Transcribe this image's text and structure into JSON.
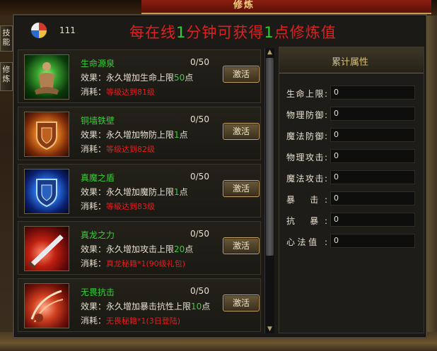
{
  "window": {
    "title": "修炼"
  },
  "side_tabs": [
    {
      "label": "技能"
    },
    {
      "label": "修炼"
    }
  ],
  "header": {
    "coin_icon": "yin-yang-coin-icon",
    "coin_count": "111",
    "banner_prefix": "每在线",
    "banner_num1": "1",
    "banner_mid": "分钟可获得",
    "banner_num2": "1",
    "banner_suffix": "点修炼值"
  },
  "skills": [
    {
      "icon": "meditating-figure-icon",
      "name": "生命源泉",
      "progress": "0/50",
      "effect_prefix": "效果：永久增加生命上限",
      "effect_value": "50",
      "effect_unit": "点",
      "cost_label": "消耗：",
      "cost_req": "等级达到81级",
      "button": "激活"
    },
    {
      "icon": "bronze-shield-icon",
      "name": "铜墙铁壁",
      "progress": "0/50",
      "effect_prefix": "效果：永久增加物防上限",
      "effect_value": "1",
      "effect_unit": "点",
      "cost_label": "消耗：",
      "cost_req": "等级达到82级",
      "button": "激活"
    },
    {
      "icon": "blue-shield-icon",
      "name": "真魔之盾",
      "progress": "0/50",
      "effect_prefix": "效果：永久增加魔防上限",
      "effect_value": "1",
      "effect_unit": "点",
      "cost_label": "消耗：",
      "cost_req": "等级达到83级",
      "button": "激活"
    },
    {
      "icon": "sword-slash-icon",
      "name": "真龙之力",
      "progress": "0/50",
      "effect_prefix": "效果：永久增加攻击上限",
      "effect_value": "20",
      "effect_unit": "点",
      "cost_label": "消耗：",
      "cost_req": "真龙秘籍*1(90级礼包)",
      "button": "激活"
    },
    {
      "icon": "fearless-strike-icon",
      "name": "无畏抗击",
      "progress": "0/50",
      "effect_prefix": "效果：永久增加暴击抗性上限",
      "effect_value": "10",
      "effect_unit": "点",
      "cost_label": "消耗：",
      "cost_req": "无畏秘籍*1(3日登陆)",
      "button": "激活"
    }
  ],
  "stats": {
    "title": "累计属性",
    "rows": [
      {
        "label": "生命上限:",
        "value": "0"
      },
      {
        "label": "物理防御:",
        "value": "0"
      },
      {
        "label": "魔法防御:",
        "value": "0"
      },
      {
        "label": "物理攻击:",
        "value": "0"
      },
      {
        "label": "魔法攻击:",
        "value": "0"
      },
      {
        "label": "暴  击:",
        "value": "0"
      },
      {
        "label": "抗  暴:",
        "value": "0"
      },
      {
        "label": "心法值  :",
        "value": "0"
      }
    ]
  },
  "colors": {
    "accent_green": "#3ad03a",
    "accent_red": "#e02020",
    "gold": "#d8c078"
  }
}
